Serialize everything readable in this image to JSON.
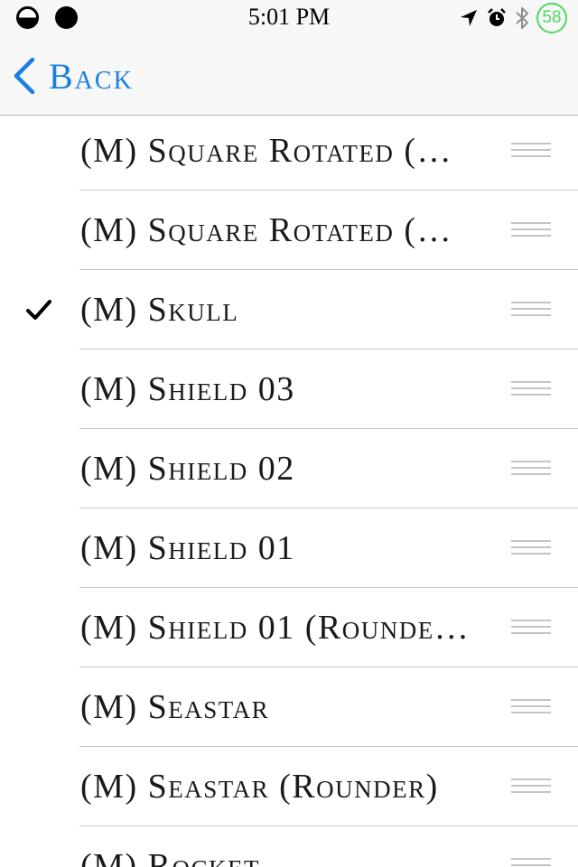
{
  "status_bar": {
    "time": "5:01 PM",
    "battery_percent": "58",
    "icons": [
      "signal-dot-icon",
      "signal-dot-icon",
      "location-arrow-icon",
      "alarm-clock-icon",
      "bluetooth-icon",
      "battery-ring-icon"
    ]
  },
  "nav": {
    "back_label": "Back"
  },
  "list": {
    "items": [
      {
        "label": "(M) Square Rotated (…",
        "checked": false
      },
      {
        "label": "(M) Square Rotated (…",
        "checked": false
      },
      {
        "label": "(M) Skull",
        "checked": true
      },
      {
        "label": "(M) Shield 03",
        "checked": false
      },
      {
        "label": "(M) Shield 02",
        "checked": false
      },
      {
        "label": "(M) Shield 01",
        "checked": false
      },
      {
        "label": "(M) Shield 01 (Rounde…",
        "checked": false
      },
      {
        "label": "(M) Seastar",
        "checked": false
      },
      {
        "label": "(M) Seastar (Rounder)",
        "checked": false
      },
      {
        "label": "(M) Rocket",
        "checked": false
      }
    ]
  },
  "colors": {
    "accent": "#1a7fe0",
    "battery": "#4cd964",
    "separator": "#c8c7cc"
  }
}
